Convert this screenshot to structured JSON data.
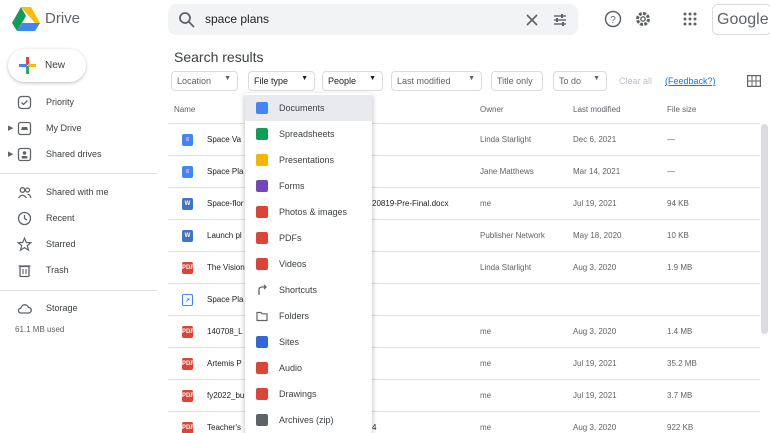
{
  "app": {
    "name": "Drive",
    "brand": "Google"
  },
  "search": {
    "value": "space plans"
  },
  "sidebar": {
    "new_label": "New",
    "items": [
      {
        "label": "Priority",
        "icon": "check-circle-icon"
      },
      {
        "label": "My Drive",
        "icon": "drive-folder-icon"
      },
      {
        "label": "Shared drives",
        "icon": "shared-drives-icon"
      },
      {
        "label": "Shared with me",
        "icon": "people-icon"
      },
      {
        "label": "Recent",
        "icon": "clock-icon"
      },
      {
        "label": "Starred",
        "icon": "star-icon"
      },
      {
        "label": "Trash",
        "icon": "trash-icon"
      },
      {
        "label": "Storage",
        "icon": "cloud-icon"
      }
    ],
    "storage_used": "61.1 MB used"
  },
  "main": {
    "title": "Search results",
    "chips": [
      {
        "label": "Location"
      },
      {
        "label": "File type"
      },
      {
        "label": "People"
      },
      {
        "label": "Last modified"
      },
      {
        "label": "Title only"
      },
      {
        "label": "To do"
      }
    ],
    "clear_all": "Clear all",
    "feedback": "(Feedback?)",
    "columns": {
      "name": "Name",
      "owner": "Owner",
      "modified": "Last modified",
      "size": "File size"
    },
    "rows": [
      {
        "name": "Space Va",
        "type": "doc",
        "owner": "Linda Starlight",
        "modified": "Dec 6, 2021",
        "size": "—"
      },
      {
        "name": "Space Pla",
        "type": "doc",
        "owner": "Jane Matthews",
        "modified": "Mar 14, 2021",
        "size": "—"
      },
      {
        "name": "Space-flor",
        "type": "word",
        "name_tail": "20819-Pre-Final.docx",
        "owner": "me",
        "modified": "Jul 19, 2021",
        "size": "94 KB"
      },
      {
        "name": "Launch pl",
        "type": "word",
        "owner": "Publisher Network",
        "modified": "May 18, 2020",
        "size": "10 KB"
      },
      {
        "name": "The Vision",
        "type": "pdf",
        "owner": "Linda Starlight",
        "modified": "Aug 3, 2020",
        "size": "1.9 MB"
      },
      {
        "name": "Space Pla",
        "type": "shortcut",
        "owner": "",
        "modified": "",
        "size": ""
      },
      {
        "name": "140708_L",
        "type": "pdf",
        "owner": "me",
        "modified": "Aug 3, 2020",
        "size": "1.4 MB"
      },
      {
        "name": "Artemis P",
        "type": "pdf",
        "owner": "me",
        "modified": "Jul 19, 2021",
        "size": "35.2 MB"
      },
      {
        "name": "fy2022_bu",
        "type": "pdf",
        "owner": "me",
        "modified": "Jul 19, 2021",
        "size": "3.7 MB"
      },
      {
        "name": "Teacher's",
        "type": "pdf",
        "name_tail": "4",
        "owner": "me",
        "modified": "Aug 3, 2020",
        "size": "922 KB"
      }
    ]
  },
  "file_type_menu": {
    "selected": "Documents",
    "items": [
      {
        "label": "Documents",
        "icon": "docs-icon",
        "color": "#4285f4"
      },
      {
        "label": "Spreadsheets",
        "icon": "sheets-icon",
        "color": "#0f9d58"
      },
      {
        "label": "Presentations",
        "icon": "slides-icon",
        "color": "#f4b400"
      },
      {
        "label": "Forms",
        "icon": "forms-icon",
        "color": "#7248b9"
      },
      {
        "label": "Photos & images",
        "icon": "image-icon",
        "color": "#db4437"
      },
      {
        "label": "PDFs",
        "icon": "pdf-icon",
        "color": "#db4437"
      },
      {
        "label": "Videos",
        "icon": "video-icon",
        "color": "#db4437"
      },
      {
        "label": "Shortcuts",
        "icon": "shortcut-icon",
        "color": "#5f6368"
      },
      {
        "label": "Folders",
        "icon": "folder-icon",
        "color": "#5f6368"
      },
      {
        "label": "Sites",
        "icon": "sites-icon",
        "color": "#3367d6"
      },
      {
        "label": "Audio",
        "icon": "audio-icon",
        "color": "#db4437"
      },
      {
        "label": "Drawings",
        "icon": "drawings-icon",
        "color": "#db4437"
      },
      {
        "label": "Archives (zip)",
        "icon": "archive-icon",
        "color": "#5f6368"
      }
    ]
  },
  "colors": {
    "accent": "#1a73e8",
    "doc": "#4285f4",
    "word": "#2b579a",
    "pdf": "#db4437"
  }
}
